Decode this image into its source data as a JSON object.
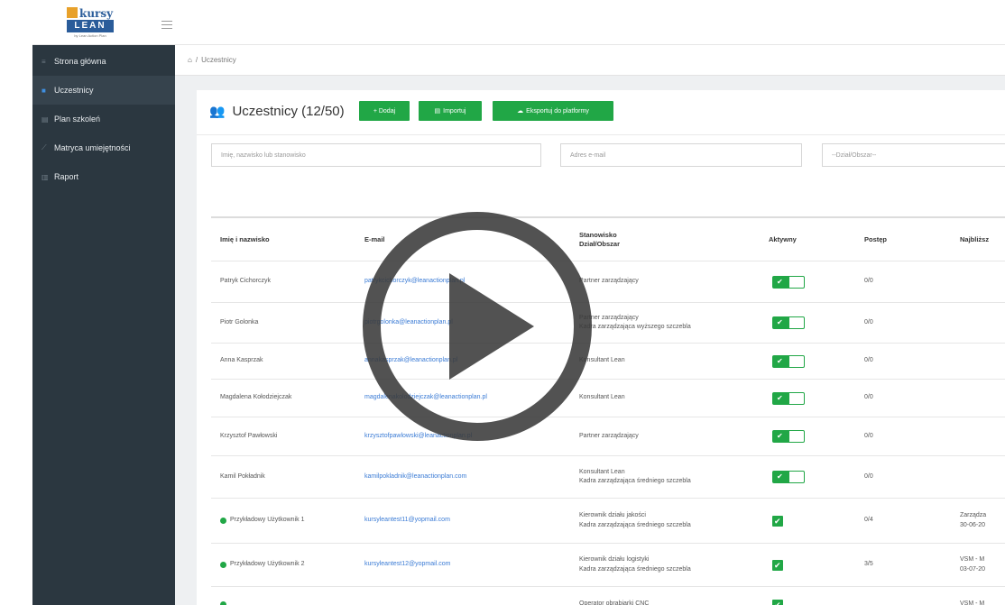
{
  "logo": {
    "word1": "kursy",
    "word2": "LEAN",
    "subtitle": "by Lean Action Plan"
  },
  "sidebar": {
    "items": [
      {
        "label": "Strona główna",
        "icon": "home-icon",
        "active": false
      },
      {
        "label": "Uczestnicy",
        "icon": "users-icon",
        "active": true
      },
      {
        "label": "Plan szkoleń",
        "icon": "calendar-icon",
        "active": false
      },
      {
        "label": "Matryca umiejętności",
        "icon": "chart-icon",
        "active": false
      },
      {
        "label": "Raport",
        "icon": "report-icon",
        "active": false
      }
    ]
  },
  "breadcrumb": {
    "home": "home-icon",
    "separator": "/",
    "current": "Uczestnicy"
  },
  "header": {
    "title": "Uczestnicy (12/50)",
    "buttons": {
      "add": "+ Dodaj",
      "import": "Importuj",
      "export": "Eksportuj do platformy"
    }
  },
  "filters": {
    "name_placeholder": "Imię, nazwisko lub stanowisko",
    "email_placeholder": "Adres e-mail",
    "department_placeholder": "--Dział/Obszar--"
  },
  "table": {
    "columns": {
      "name": "Imię i nazwisko",
      "email": "E-mail",
      "position_line1": "Stanowisko",
      "position_line2": "Dział/Obszar",
      "active": "Aktywny",
      "progress": "Postęp",
      "nearest": "Najbliższ"
    },
    "rows": [
      {
        "name": "Patryk Cichorczyk",
        "email": "patrykcichorczyk@leanactionplan.pl",
        "pos1": "Partner zarządzający",
        "pos2": "",
        "progress": "0/0",
        "nearest1": "",
        "nearest2": "",
        "marker": false,
        "toggle": true
      },
      {
        "name": "Piotr Golonka",
        "email": "piotrgolonka@leanactionplan.pl",
        "pos1": "Partner zarządzający",
        "pos2": "Kadra zarządzająca wyższego szczebla",
        "progress": "0/0",
        "nearest1": "",
        "nearest2": "",
        "marker": false,
        "toggle": true
      },
      {
        "name": "Anna Kasprzak",
        "email": "annakasprzak@leanactionplan.pl",
        "pos1": "Konsultant Lean",
        "pos2": "",
        "progress": "0/0",
        "nearest1": "",
        "nearest2": "",
        "marker": false,
        "toggle": true
      },
      {
        "name": "Magdalena Kołodziejczak",
        "email": "magdalenakolodziejczak@leanactionplan.pl",
        "pos1": "Konsultant Lean",
        "pos2": "",
        "progress": "0/0",
        "nearest1": "",
        "nearest2": "",
        "marker": false,
        "toggle": true
      },
      {
        "name": "Krzysztof Pawłowski",
        "email": "krzysztofpawlowski@leanactionplan.pl",
        "pos1": "Partner zarządzający",
        "pos2": "",
        "progress": "0/0",
        "nearest1": "",
        "nearest2": "",
        "marker": false,
        "toggle": true
      },
      {
        "name": "Kamil Pokładnik",
        "email": "kamilpokladnik@leanactionplan.com",
        "pos1": "Konsultant Lean",
        "pos2": "Kadra zarządzająca średniego szczebla",
        "progress": "0/0",
        "nearest1": "",
        "nearest2": "",
        "marker": false,
        "toggle": true
      },
      {
        "name": "Przykładowy Użytkownik 1",
        "email": "kursyleantest11@yopmail.com",
        "pos1": "Kierownik działu jakości",
        "pos2": "Kadra zarządzająca średniego szczebla",
        "progress": "0/4",
        "nearest1": "Zarządza",
        "nearest2": "30-06-20",
        "marker": true,
        "toggle": false
      },
      {
        "name": "Przykładowy Użytkownik 2",
        "email": "kursyleantest12@yopmail.com",
        "pos1": "Kierownik działu logistyki",
        "pos2": "Kadra zarządzająca średniego szczebla",
        "progress": "3/5",
        "nearest1": "VSM - M",
        "nearest2": "03-07-20",
        "marker": true,
        "toggle": false
      },
      {
        "name": "",
        "email": "",
        "pos1": "Operator obrabiarki CNC",
        "pos2": "",
        "progress": "",
        "nearest1": "VSM - M",
        "nearest2": "",
        "marker": true,
        "toggle": false
      }
    ]
  }
}
